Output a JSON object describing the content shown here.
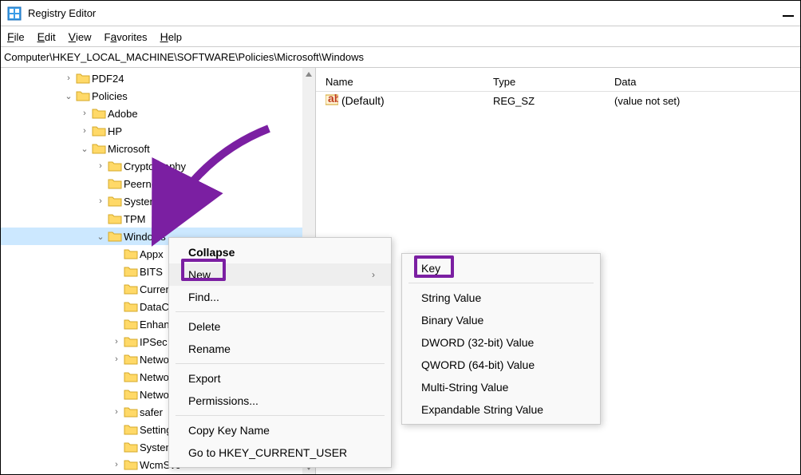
{
  "window": {
    "title": "Registry Editor"
  },
  "menu": {
    "file": "File",
    "edit": "Edit",
    "view": "View",
    "favorites": "Favorites",
    "help": "Help"
  },
  "address": "Computer\\HKEY_LOCAL_MACHINE\\SOFTWARE\\Policies\\Microsoft\\Windows",
  "columns": {
    "name": "Name",
    "type": "Type",
    "data": "Data"
  },
  "value_row": {
    "name": "(Default)",
    "type": "REG_SZ",
    "data": "(value not set)"
  },
  "tree": {
    "pdf24": "PDF24",
    "policies": "Policies",
    "adobe": "Adobe",
    "hp": "HP",
    "microsoft": "Microsoft",
    "cryptography": "Cryptography",
    "peernet": "Peernet",
    "systemcerts": "SystemCertificat",
    "tpm": "TPM",
    "windows": "Windows",
    "appx": "Appx",
    "bits": "BITS",
    "current": "Curren",
    "datac": "DataC",
    "enhanc": "Enhanc",
    "ipsec": "IPSec",
    "netwo1": "Netwo",
    "netwo2": "Netwo",
    "netwo3": "Netwo",
    "safer": "safer",
    "setting": "Setting",
    "system": "System",
    "wcmsvc": "WcmSvc"
  },
  "cmenu": {
    "collapse": "Collapse",
    "new": "New",
    "find": "Find...",
    "delete": "Delete",
    "rename": "Rename",
    "export": "Export",
    "permissions": "Permissions...",
    "copy_key": "Copy Key Name",
    "goto_hkcu": "Go to HKEY_CURRENT_USER"
  },
  "submenu": {
    "key": "Key",
    "string": "String Value",
    "binary": "Binary Value",
    "dword": "DWORD (32-bit) Value",
    "qword": "QWORD (64-bit) Value",
    "multi": "Multi-String Value",
    "expand": "Expandable String Value"
  }
}
